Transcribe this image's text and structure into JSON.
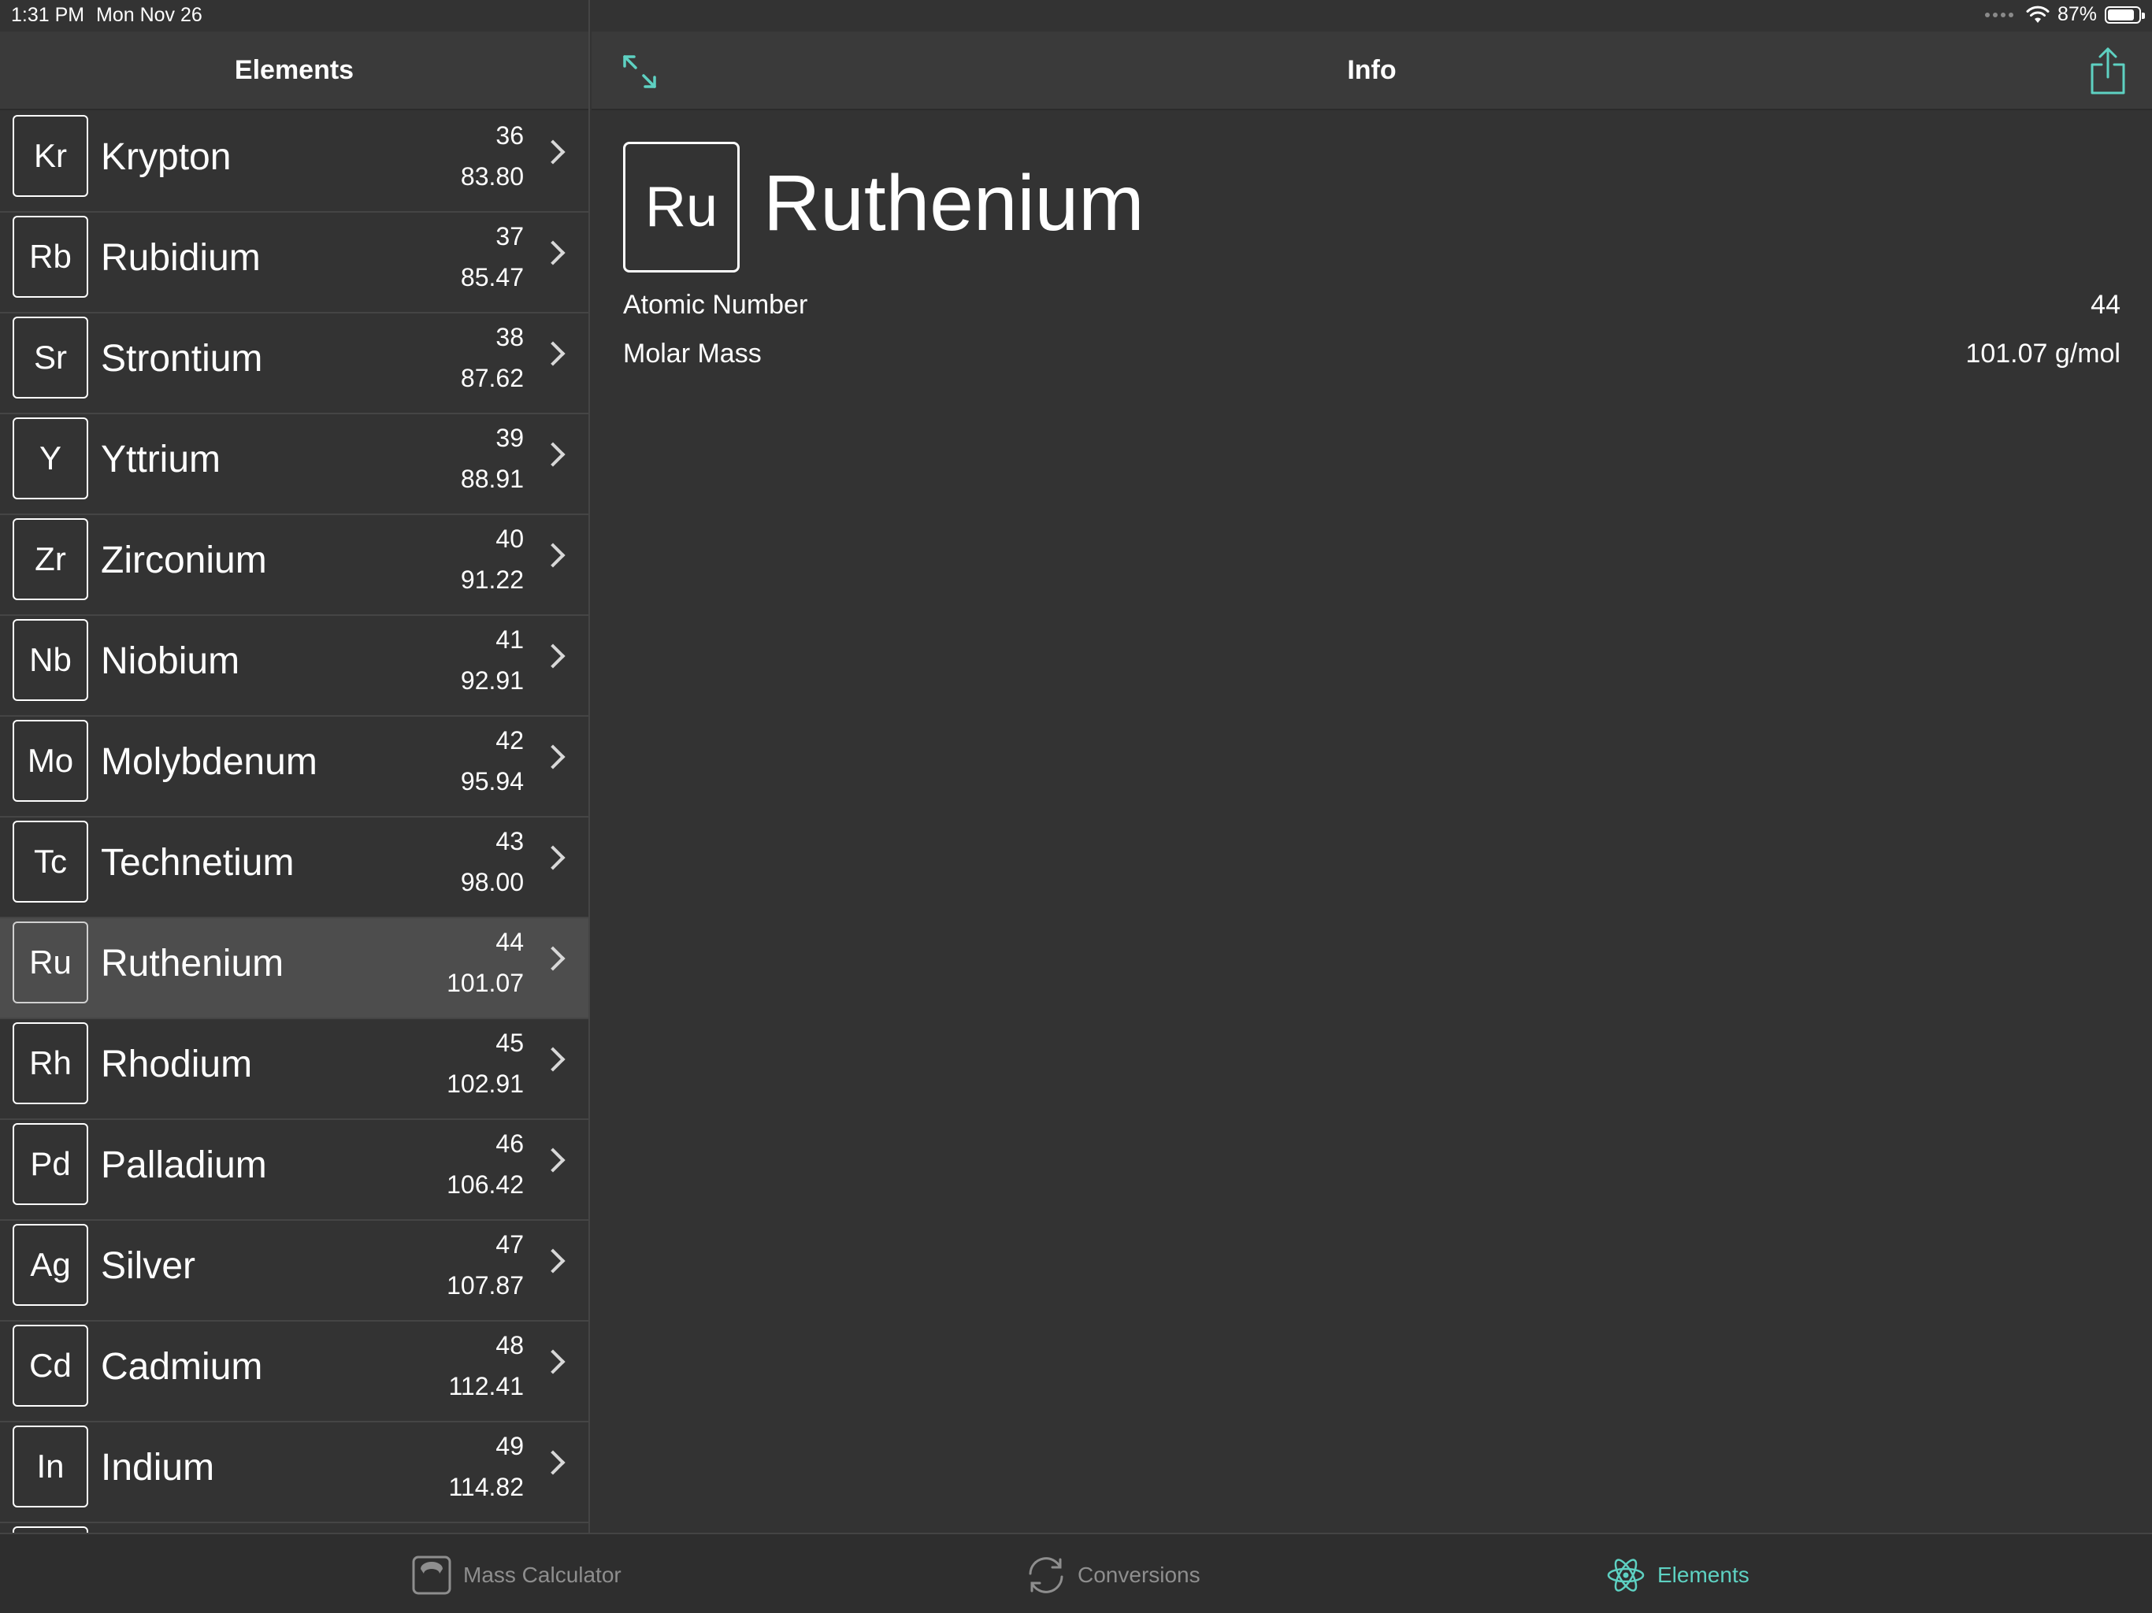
{
  "status_bar": {
    "time": "1:31 PM",
    "date": "Mon Nov 26",
    "battery": "87%",
    "battery_level": 0.87
  },
  "sidebar": {
    "title": "Elements",
    "elements": [
      {
        "symbol": "Kr",
        "name": "Krypton",
        "number": "36",
        "mass": "83.80"
      },
      {
        "symbol": "Rb",
        "name": "Rubidium",
        "number": "37",
        "mass": "85.47"
      },
      {
        "symbol": "Sr",
        "name": "Strontium",
        "number": "38",
        "mass": "87.62"
      },
      {
        "symbol": "Y",
        "name": "Yttrium",
        "number": "39",
        "mass": "88.91"
      },
      {
        "symbol": "Zr",
        "name": "Zirconium",
        "number": "40",
        "mass": "91.22"
      },
      {
        "symbol": "Nb",
        "name": "Niobium",
        "number": "41",
        "mass": "92.91"
      },
      {
        "symbol": "Mo",
        "name": "Molybdenum",
        "number": "42",
        "mass": "95.94"
      },
      {
        "symbol": "Tc",
        "name": "Technetium",
        "number": "43",
        "mass": "98.00"
      },
      {
        "symbol": "Ru",
        "name": "Ruthenium",
        "number": "44",
        "mass": "101.07"
      },
      {
        "symbol": "Rh",
        "name": "Rhodium",
        "number": "45",
        "mass": "102.91"
      },
      {
        "symbol": "Pd",
        "name": "Palladium",
        "number": "46",
        "mass": "106.42"
      },
      {
        "symbol": "Ag",
        "name": "Silver",
        "number": "47",
        "mass": "107.87"
      },
      {
        "symbol": "Cd",
        "name": "Cadmium",
        "number": "48",
        "mass": "112.41"
      },
      {
        "symbol": "In",
        "name": "Indium",
        "number": "49",
        "mass": "114.82"
      }
    ]
  },
  "detail": {
    "title": "Info",
    "symbol": "Ru",
    "name": "Ruthenium",
    "properties": [
      {
        "label": "Atomic Number",
        "value": "44"
      },
      {
        "label": "Molar Mass",
        "value": "101.07 g/mol"
      }
    ]
  },
  "tabbar": {
    "tabs": [
      {
        "label": "Mass Calculator",
        "icon": "scale-icon"
      },
      {
        "label": "Conversions",
        "icon": "refresh-icon"
      },
      {
        "label": "Elements",
        "icon": "atom-icon"
      }
    ]
  },
  "colors": {
    "background": "#333333",
    "header": "#3a3a3a",
    "selected_row": "#4d4d4d",
    "accent": "#5ed1c2",
    "tab_inactive": "#8e8e8e"
  }
}
